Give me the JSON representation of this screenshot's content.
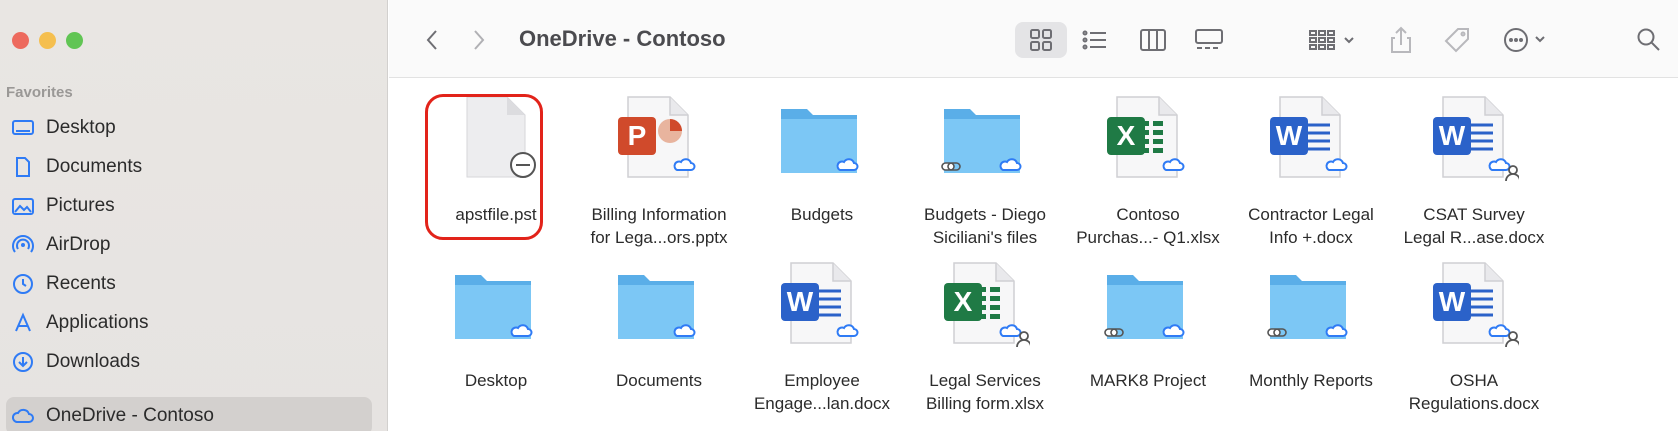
{
  "window": {
    "title": "OneDrive - Contoso"
  },
  "sidebar": {
    "section_label": "Favorites",
    "items": [
      {
        "label": "Desktop",
        "icon": "desktop-icon"
      },
      {
        "label": "Documents",
        "icon": "document-icon"
      },
      {
        "label": "Pictures",
        "icon": "pictures-icon"
      },
      {
        "label": "AirDrop",
        "icon": "airdrop-icon"
      },
      {
        "label": "Recents",
        "icon": "clock-icon"
      },
      {
        "label": "Applications",
        "icon": "applications-icon"
      },
      {
        "label": "Downloads",
        "icon": "download-icon"
      },
      {
        "label": "OneDrive - Contoso",
        "icon": "cloud-icon",
        "selected": true
      }
    ]
  },
  "toolbar": {
    "back": "chevron-left-icon",
    "forward": "chevron-right-icon",
    "views": [
      "icon-view",
      "list-view",
      "column-view",
      "gallery-view"
    ],
    "group": "group-icon",
    "share": "share-icon",
    "tag": "tag-icon",
    "more": "more-icon",
    "search": "search-icon"
  },
  "files": [
    {
      "name": "apstfile.pst",
      "type": "generic",
      "status": "blocked"
    },
    {
      "name": "Billing Information\nfor Lega...ors.pptx",
      "type": "pptx",
      "status": "cloud"
    },
    {
      "name": "Budgets",
      "type": "folder",
      "status": "cloud"
    },
    {
      "name": "Budgets - Diego\nSiciliani's files",
      "type": "folder",
      "status": "cloud-link"
    },
    {
      "name": "Contoso\nPurchas...- Q1.xlsx",
      "type": "xlsx",
      "status": "cloud"
    },
    {
      "name": "Contractor Legal\nInfo +.docx",
      "type": "docx",
      "status": "cloud"
    },
    {
      "name": "CSAT Survey\nLegal R...ase.docx",
      "type": "docx",
      "status": "cloud-shared"
    },
    {
      "name": "Desktop",
      "type": "folder",
      "status": "cloud"
    },
    {
      "name": "Documents",
      "type": "folder",
      "status": "cloud"
    },
    {
      "name": "Employee\nEngage...lan.docx",
      "type": "docx",
      "status": "cloud"
    },
    {
      "name": "Legal Services\nBilling form.xlsx",
      "type": "xlsx",
      "status": "cloud-shared"
    },
    {
      "name": "MARK8 Project",
      "type": "folder",
      "status": "cloud-link"
    },
    {
      "name": "Monthly Reports",
      "type": "folder",
      "status": "cloud-link"
    },
    {
      "name": "OSHA\nRegulations.docx",
      "type": "docx",
      "status": "cloud-shared"
    }
  ],
  "colors": {
    "folder": "#7cc7f5",
    "word": "#2b62c9",
    "excel": "#1f7a45",
    "powerpoint": "#d04a2b",
    "highlight": "#e2231a"
  }
}
